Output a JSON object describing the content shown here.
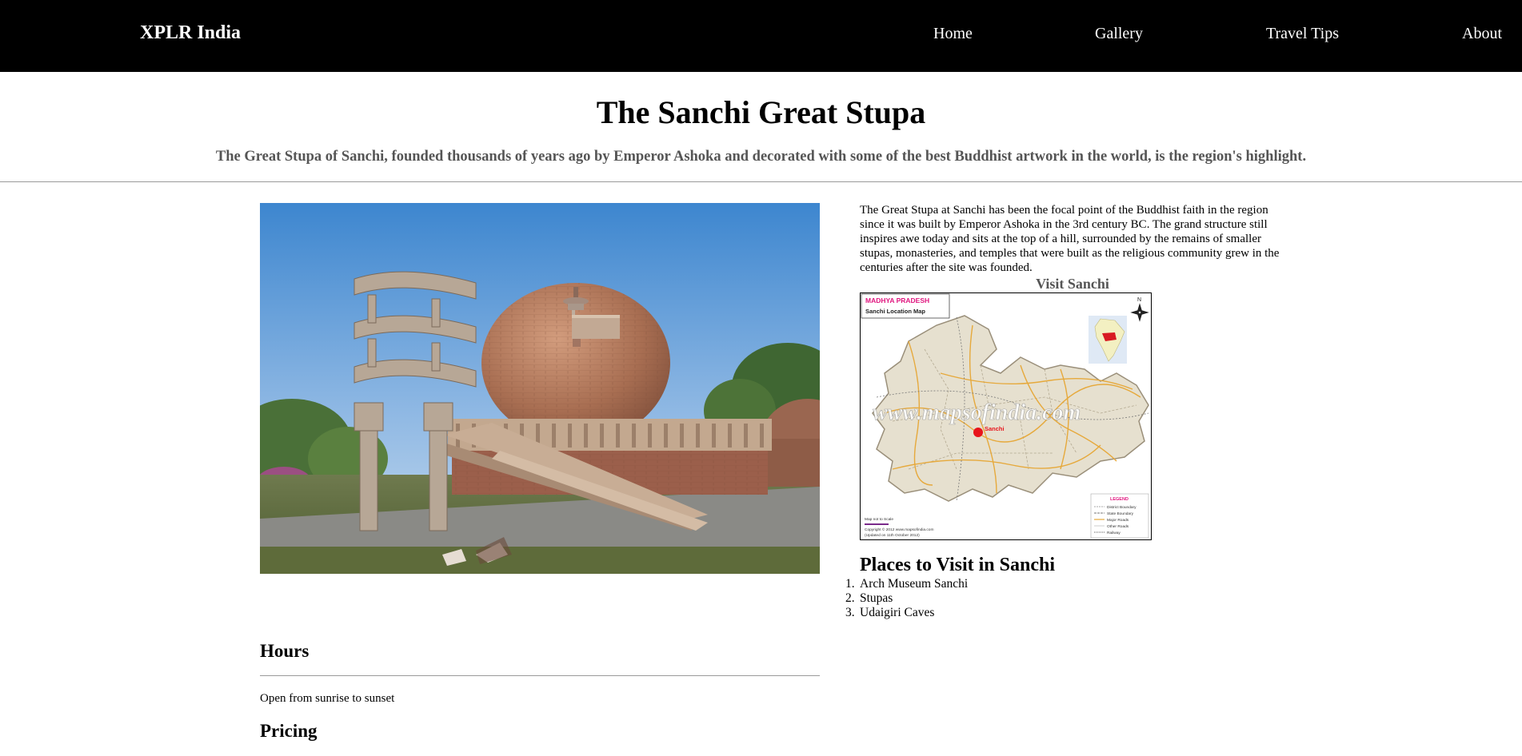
{
  "navbar": {
    "brand": "XPLR India",
    "links": [
      "Home",
      "Gallery",
      "Travel Tips",
      "About"
    ]
  },
  "header": {
    "title": "The Sanchi Great Stupa",
    "subtitle": "The Great Stupa of Sanchi, founded thousands of years ago by Emperor Ashoka and decorated with some of the best Buddhist artwork in the world, is the region's highlight."
  },
  "main": {
    "intro": "The Great Stupa at Sanchi has been the focal point of the Buddhist faith in the region since it was built by Emperor Ashoka in the 3rd century BC. The grand structure still inspires awe today and sits at the top of a hill, surrounded by the remains of smaller stupas, monasteries, and temples that were built as the religious community grew in the centuries after the site was founded.",
    "map_caption": "Visit Sanchi",
    "map": {
      "heading": "MADHYA PRADESH",
      "subheading": "Sanchi Location Map",
      "city_label": "Sanchi",
      "watermark": "www.mapsofindia.com",
      "north": "N",
      "legend_title": "LEGEND",
      "legend_items": [
        "District Boundary",
        "State Boundary",
        "Major Roads",
        "Other Roads",
        "Railway"
      ],
      "scale_note": "Map not to Scale",
      "copyright": "Copyright © 2012 www.mapsofindia.com",
      "updated": "(Updated on 11th October 2012)"
    },
    "places_title": "Places to Visit in Sanchi",
    "places": [
      "Arch Museum Sanchi",
      "Stupas",
      "Udaigiri Caves"
    ],
    "hours_title": "Hours",
    "hours_text": "Open from sunrise to sunset",
    "pricing_title": "Pricing"
  },
  "colors": {
    "navbar_bg": "#000000",
    "subtitle": "#555555",
    "map_state_fill": "#e6e0cf",
    "map_roads": "#e6a93c",
    "map_marker": "#e8141c",
    "map_heading": "#e0167f"
  }
}
